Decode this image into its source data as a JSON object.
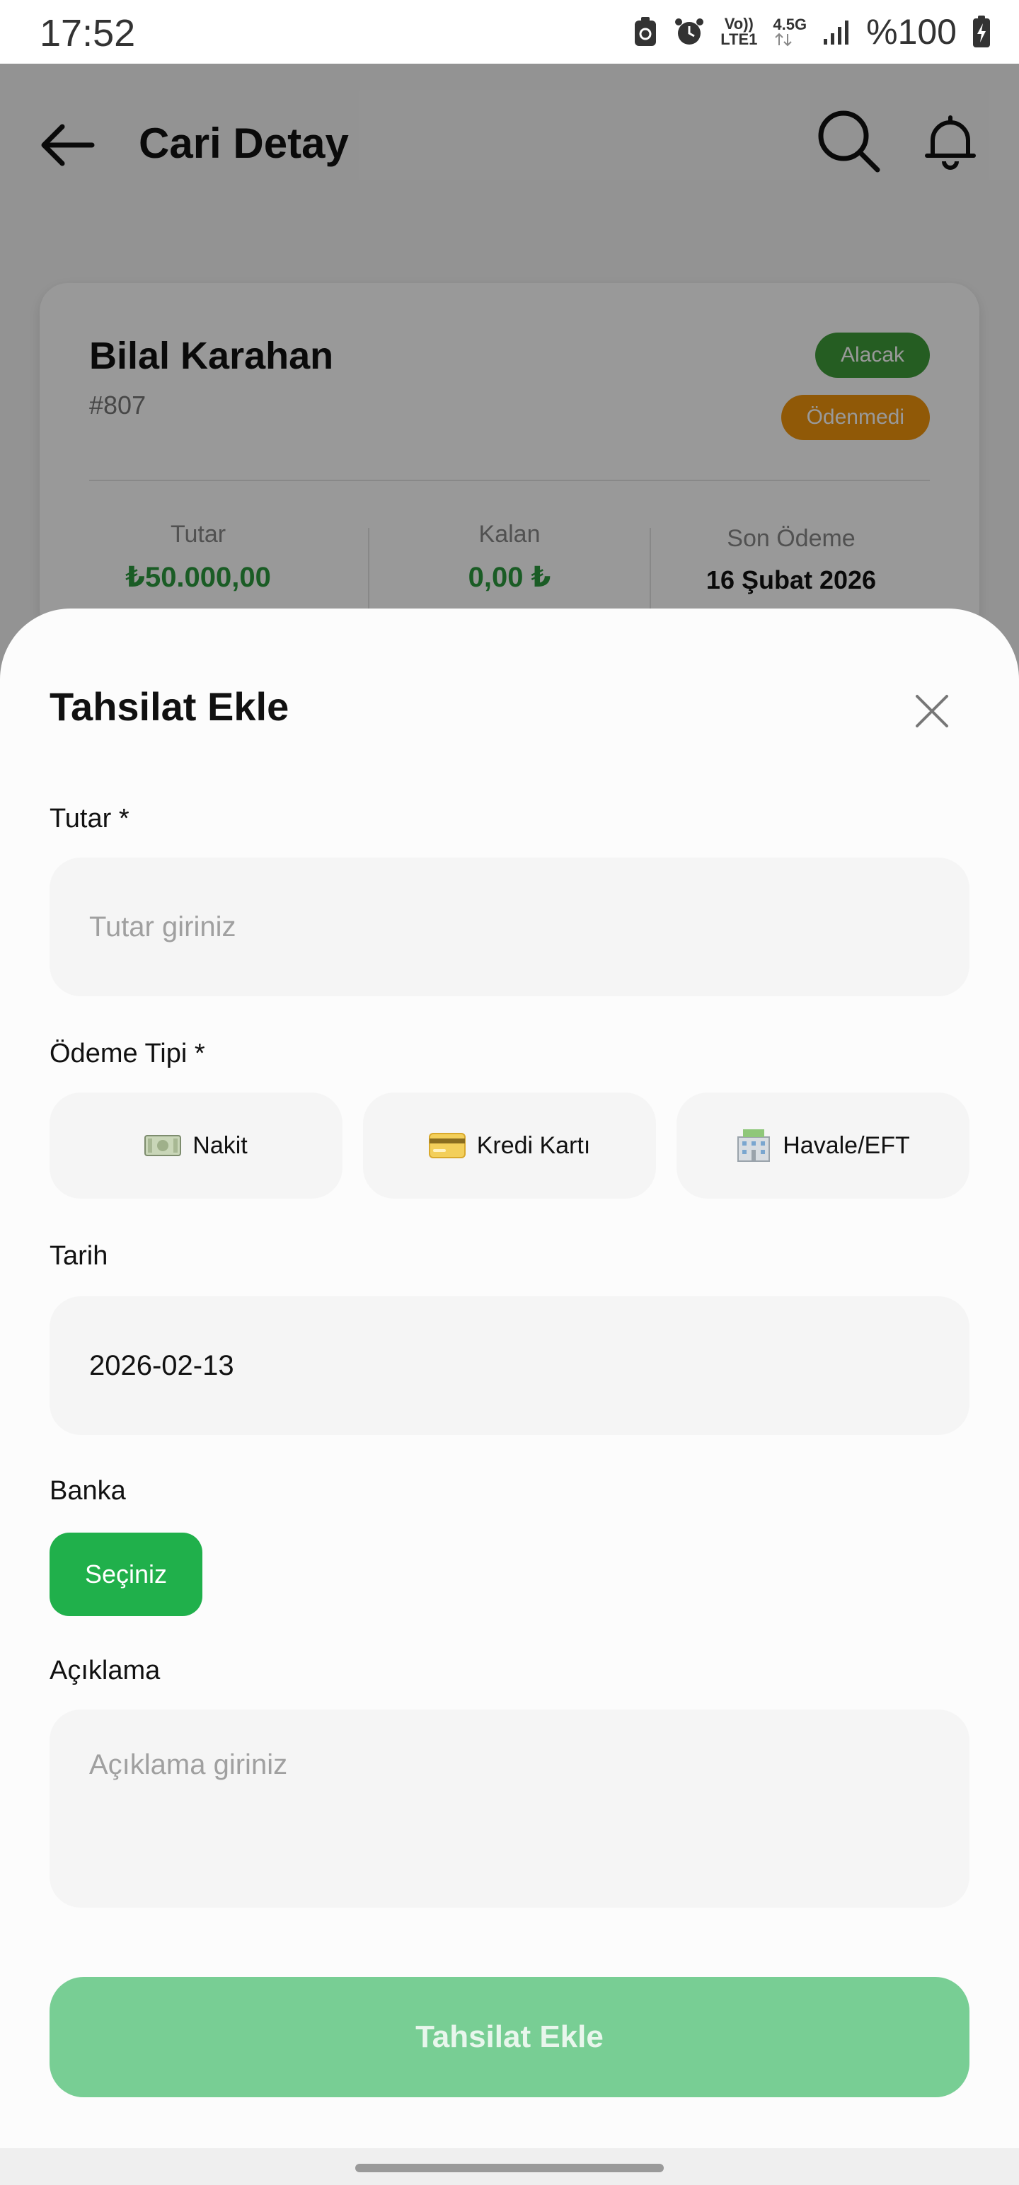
{
  "status_bar": {
    "time": "17:52",
    "volte": "Vo))",
    "lte": "LTE1",
    "net": "4.5G",
    "battery": "%100"
  },
  "header": {
    "title": "Cari Detay",
    "icons": [
      "back-arrow-icon",
      "search-icon",
      "bell-icon"
    ]
  },
  "cari_card": {
    "name": "Bilal Karahan",
    "code": "#807",
    "badges": {
      "type": "Alacak",
      "status": "Ödenmedi"
    },
    "stats": [
      {
        "label": "Tutar",
        "value": "₺50.000,00",
        "color": "#2c9a3e"
      },
      {
        "label": "Kalan",
        "value": "0,00 ₺",
        "color": "#2c9a3e"
      },
      {
        "label": "Son Ödeme",
        "value": "16 Şubat 2026",
        "color": "#111111"
      }
    ]
  },
  "sheet": {
    "title": "Tahsilat Ekle",
    "amount": {
      "label": "Tutar *",
      "placeholder": "Tutar giriniz"
    },
    "payment_type": {
      "label": "Ödeme Tipi *",
      "options": [
        {
          "label": "Nakit",
          "icon": "banknote-icon"
        },
        {
          "label": "Kredi Kartı",
          "icon": "credit-card-icon"
        },
        {
          "label": "Havale/EFT",
          "icon": "bank-icon"
        }
      ]
    },
    "date": {
      "label": "Tarih",
      "value": "2026-02-13"
    },
    "bank": {
      "label": "Banka",
      "button": "Seçiniz"
    },
    "description": {
      "label": "Açıklama",
      "placeholder": "Açıklama giriniz"
    },
    "submit": "Tahsilat Ekle"
  },
  "colors": {
    "primary_green": "#20b04b",
    "submit_disabled": "#78ce94",
    "badge_alacak": "#3f9b3a",
    "badge_odenmedi": "#f0940d"
  }
}
